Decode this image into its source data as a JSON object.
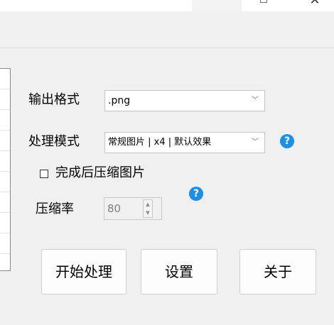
{
  "output_format": {
    "label": "输出格式",
    "value": ".png"
  },
  "process_mode": {
    "label": "处理模式",
    "value": "常规图片 | x4 | 默认效果"
  },
  "compress_after": {
    "label": "完成后压缩图片",
    "checked": false
  },
  "compression_rate": {
    "label": "压缩率",
    "value": "80"
  },
  "buttons": {
    "start": "开始处理",
    "settings": "设置",
    "about": "关于"
  },
  "icons": {
    "help": "?",
    "chevron": "﹀",
    "close": "✕",
    "spin_up": "▲",
    "spin_down": "▼"
  },
  "colors": {
    "help_icon": "#1e8fe6"
  }
}
